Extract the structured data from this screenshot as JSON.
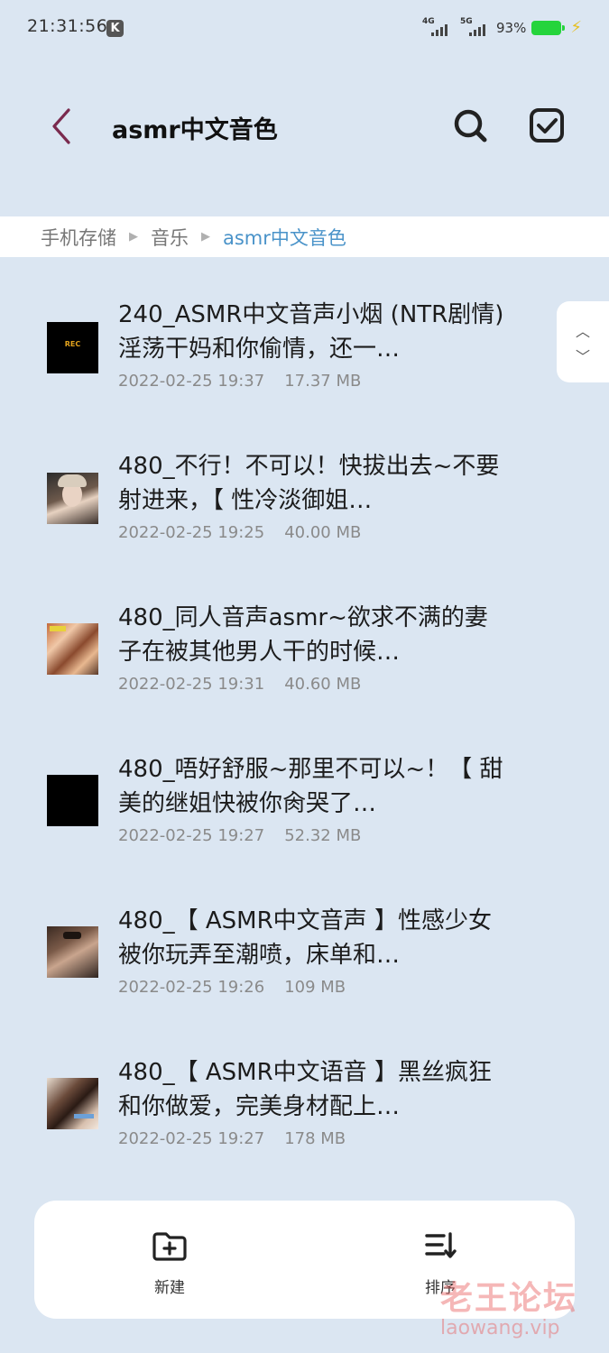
{
  "status_bar": {
    "time": "21:31:56",
    "badge": "K",
    "network_1": "4G",
    "network_2": "5G",
    "battery_percent": "93%"
  },
  "header": {
    "title": "asmr中文音色"
  },
  "breadcrumb": {
    "items": [
      "手机存储",
      "音乐",
      "asmr中文音色"
    ]
  },
  "files": [
    {
      "name": "240_ASMR中文音声小烟 (NTR剧情) 淫荡干妈和你偷情，还一…",
      "date": "2022-02-25 19:37",
      "size": "17.37 MB",
      "thumb_text": "REC"
    },
    {
      "name": "480_不行！不可以！快拔出去~不要射进来，【 性冷淡御姐…",
      "date": "2022-02-25 19:25",
      "size": "40.00 MB"
    },
    {
      "name": "480_同人音声asmr~欲求不满的妻子在被其他男人干的时候…",
      "date": "2022-02-25 19:31",
      "size": "40.60 MB"
    },
    {
      "name": "480_唔好舒服~那里不可以~！【 甜美的继姐快被你肏哭了…",
      "date": "2022-02-25 19:27",
      "size": "52.32 MB"
    },
    {
      "name": "480_【 ASMR中文音声 】性感少女被你玩弄至潮喷，床单和…",
      "date": "2022-02-25 19:26",
      "size": "109 MB"
    },
    {
      "name": "480_【 ASMR中文语音 】黑丝疯狂和你做爱，完美身材配上…",
      "date": "2022-02-25 19:27",
      "size": "178 MB"
    }
  ],
  "toolbar": {
    "new_label": "新建",
    "sort_label": "排序"
  },
  "watermark": {
    "title": "老王论坛",
    "url": "laowang.vip"
  },
  "colors": {
    "background": "#dbe6f2",
    "accent": "#4a93c9",
    "back_arrow": "#7a2a4e"
  }
}
